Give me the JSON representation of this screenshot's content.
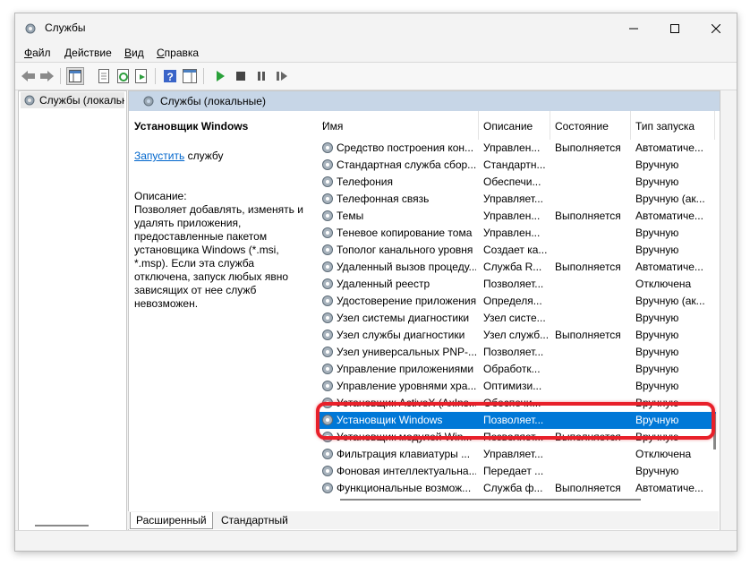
{
  "window": {
    "title": "Службы"
  },
  "menu": {
    "file": "Файл",
    "file_key": "Ф",
    "file_rest": "айл",
    "action_key": "Д",
    "action_rest": "ействие",
    "view_key": "В",
    "view_rest": "ид",
    "help_key": "С",
    "help_rest": "правка"
  },
  "tree": {
    "item": "Службы (локальны"
  },
  "pane": {
    "header": "Службы (локальные)"
  },
  "detail": {
    "service_name": "Установщик Windows",
    "start_link": "Запустить",
    "start_rest": " службу",
    "desc_title": "Описание:",
    "desc_text": "Позволяет добавлять, изменять и удалять приложения, предоставленные пакетом установщика Windows (*.msi, *.msp). Если эта служба отключена, запуск любых явно зависящих от нее служб невозможен."
  },
  "columns": {
    "name": "Имя",
    "desc": "Описание",
    "state": "Состояние",
    "start": "Тип запуска"
  },
  "rows": [
    {
      "name": "Средство построения кон...",
      "desc": "Управлен...",
      "state": "Выполняется",
      "start": "Автоматиче..."
    },
    {
      "name": "Стандартная служба сбор...",
      "desc": "Стандартн...",
      "state": "",
      "start": "Вручную"
    },
    {
      "name": "Телефония",
      "desc": "Обеспечи...",
      "state": "",
      "start": "Вручную"
    },
    {
      "name": "Телефонная связь",
      "desc": "Управляет...",
      "state": "",
      "start": "Вручную (ак..."
    },
    {
      "name": "Темы",
      "desc": "Управлен...",
      "state": "Выполняется",
      "start": "Автоматиче..."
    },
    {
      "name": "Теневое копирование тома",
      "desc": "Управлен...",
      "state": "",
      "start": "Вручную"
    },
    {
      "name": "Тополог канального уровня",
      "desc": "Создает ка...",
      "state": "",
      "start": "Вручную"
    },
    {
      "name": "Удаленный вызов процеду...",
      "desc": "Служба R...",
      "state": "Выполняется",
      "start": "Автоматиче..."
    },
    {
      "name": "Удаленный реестр",
      "desc": "Позволяет...",
      "state": "",
      "start": "Отключена"
    },
    {
      "name": "Удостоверение приложения",
      "desc": "Определя...",
      "state": "",
      "start": "Вручную (ак..."
    },
    {
      "name": "Узел системы диагностики",
      "desc": "Узел систе...",
      "state": "",
      "start": "Вручную"
    },
    {
      "name": "Узел службы диагностики",
      "desc": "Узел служб...",
      "state": "Выполняется",
      "start": "Вручную"
    },
    {
      "name": "Узел универсальных PNP-...",
      "desc": "Позволяет...",
      "state": "",
      "start": "Вручную"
    },
    {
      "name": "Управление приложениями",
      "desc": "Обработк...",
      "state": "",
      "start": "Вручную"
    },
    {
      "name": "Управление уровнями хра...",
      "desc": "Оптимизи...",
      "state": "",
      "start": "Вручную"
    },
    {
      "name": "Установщик ActiveX (AxIns...",
      "desc": "Обеспечи...",
      "state": "",
      "start": "Вручную"
    },
    {
      "name": "Установщик Windows",
      "desc": "Позволяет...",
      "state": "",
      "start": "Вручную"
    },
    {
      "name": "Установщик модулей Win...",
      "desc": "Позволяет...",
      "state": "Выполняется",
      "start": "Вручную"
    },
    {
      "name": "Фильтрация клавиатуры ...",
      "desc": "Управляет...",
      "state": "",
      "start": "Отключена"
    },
    {
      "name": "Фоновая интеллектуальна...",
      "desc": "Передает ...",
      "state": "",
      "start": "Вручную"
    },
    {
      "name": "Функциональные возмож...",
      "desc": "Служба ф...",
      "state": "Выполняется",
      "start": "Автоматиче..."
    }
  ],
  "selected_row": "Установщик Windows",
  "tabs": {
    "extended": "Расширенный",
    "standard": "Стандартный"
  },
  "colors": {
    "selection": "#0078d7",
    "pane_header": "#c7d6e7",
    "highlight": "#e8202a",
    "link": "#0066cc"
  }
}
